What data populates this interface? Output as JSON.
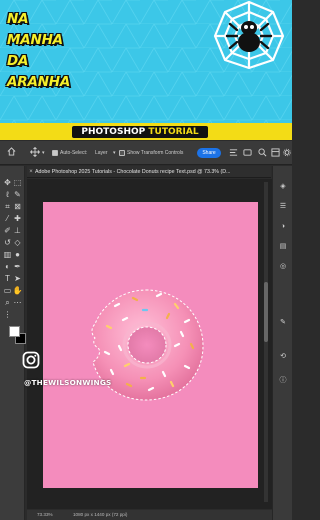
{
  "banner": {
    "brand_lines": [
      "NA",
      "MANHA",
      "DA",
      "ARANHA"
    ],
    "title_main": "PHOTOSHOP",
    "title_accent": "TUTORIAL",
    "logo_icon": "spider-web-icon",
    "colors": {
      "background": "#3cc7e8",
      "brand_text": "#f5ef2b",
      "strip": "#f3dc16"
    }
  },
  "options_bar": {
    "home_icon": "home-icon",
    "move_tool_icon": "move-icon",
    "auto_select_checked": true,
    "auto_select_label": "Auto-Select:",
    "auto_select_target": "Layer",
    "show_transform_checked": false,
    "show_transform_label": "Show Transform Controls",
    "share_label": "Share",
    "icons": [
      "align-icon",
      "3d-mode-icon",
      "search-icon",
      "workspace-icon",
      "settings-icon"
    ]
  },
  "document": {
    "tab_title": "Adobe Photoshop 2025 Tutorials - Chocolate Donuts recipe Text.psd @ 73.3% (D...",
    "canvas_color": "#f48cbd"
  },
  "toolbar": {
    "tools": [
      "move-tool-icon",
      "artboard-tool-icon",
      "lasso-tool-icon",
      "quick-selection-tool-icon",
      "crop-tool-icon",
      "frame-tool-icon",
      "eyedropper-tool-icon",
      "spot-healing-brush-icon",
      "brush-tool-icon",
      "clone-stamp-icon",
      "history-brush-icon",
      "eraser-tool-icon",
      "gradient-tool-icon",
      "blur-tool-icon",
      "dodge-tool-icon",
      "pen-tool-icon",
      "type-tool-icon",
      "path-selection-icon",
      "rectangle-tool-icon",
      "hand-tool-icon",
      "zoom-tool-icon",
      "more-tools-icon"
    ],
    "foreground_color": "#ffffff",
    "background_color": "#000000"
  },
  "right_panel": {
    "icons": [
      "layers-panel-icon",
      "properties-panel-icon",
      "adjustments-panel-icon",
      "libraries-panel-icon",
      "channels-panel-icon",
      "paths-panel-icon",
      "history-panel-icon",
      "info-panel-icon"
    ]
  },
  "status_bar": {
    "zoom": "73.33%",
    "doc_size": "1080 px x 1440 px (72 ppi)"
  },
  "watermark": {
    "icon": "instagram-icon",
    "handle": "@THEWILSONWINGS"
  }
}
